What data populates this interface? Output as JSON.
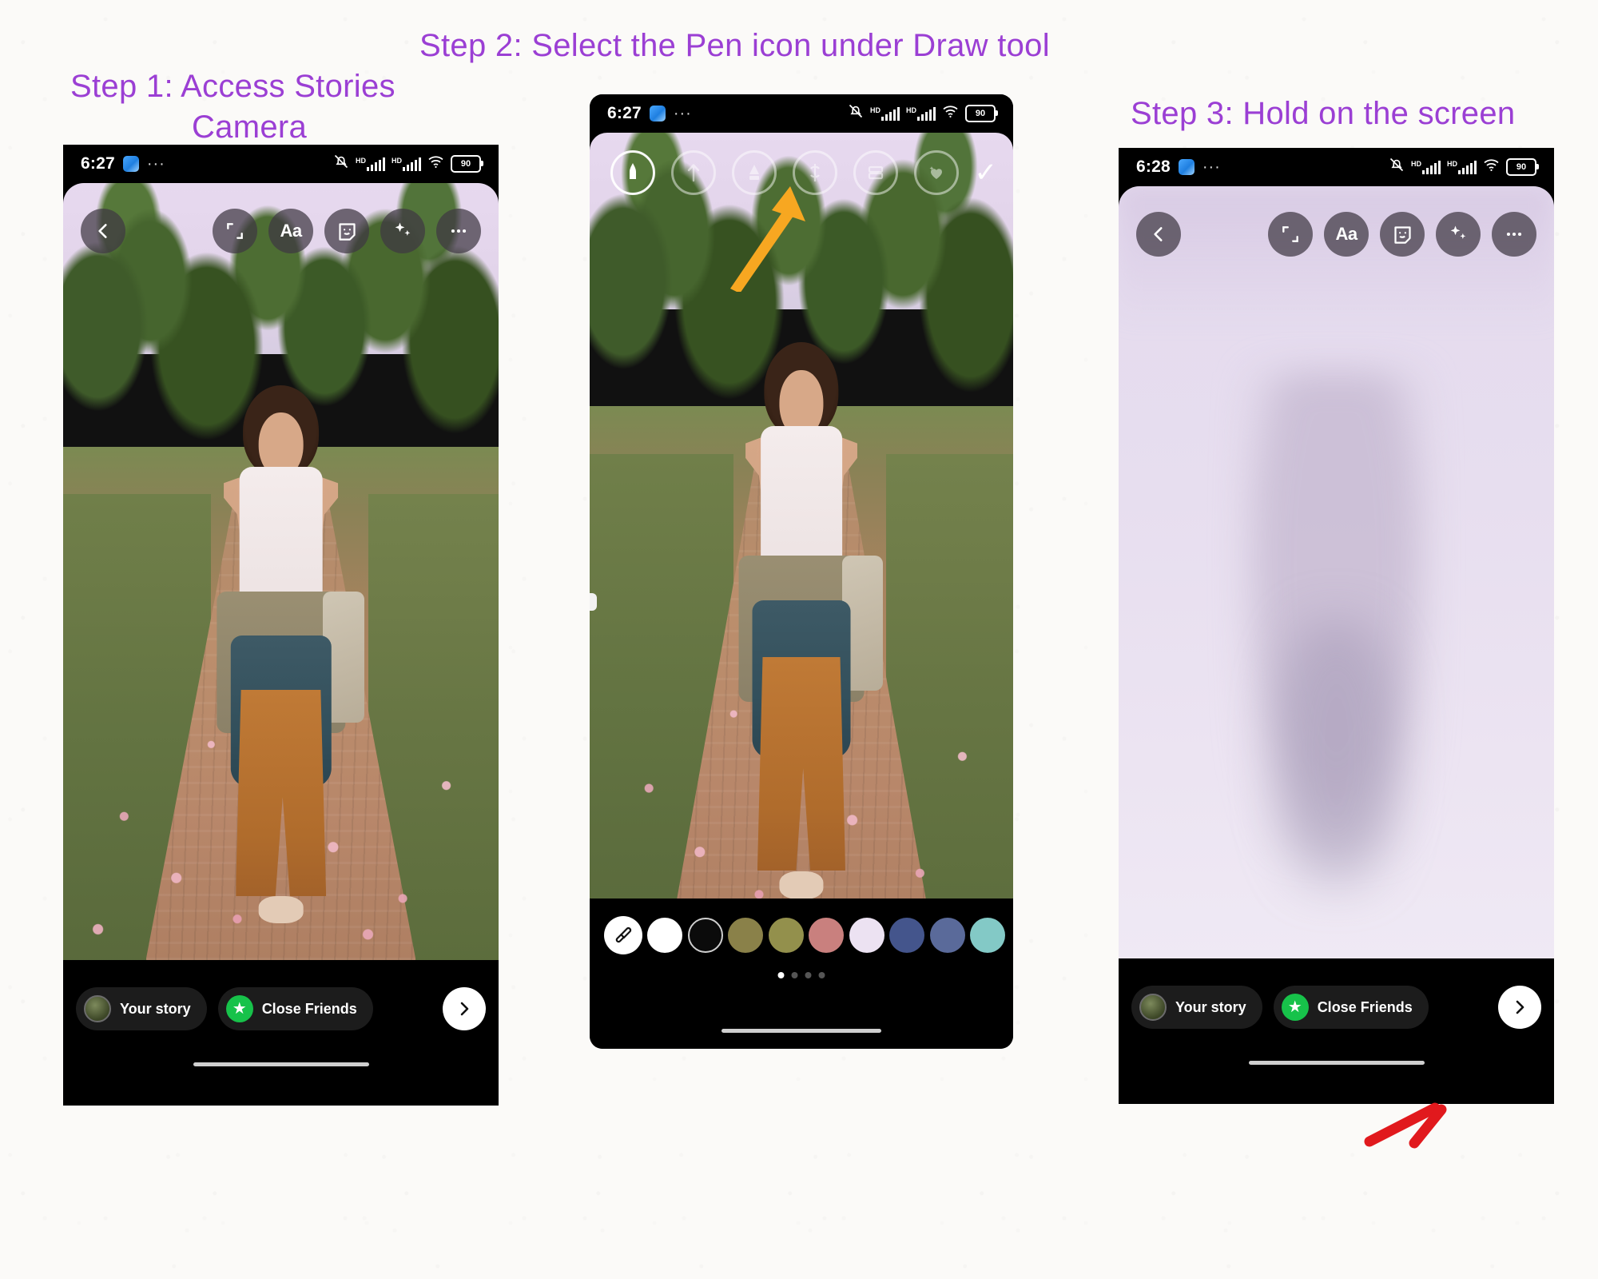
{
  "captions": {
    "step2": "Step 2: Select the Pen icon under Draw tool",
    "step1_line1": "Step 1: Access Stories",
    "step1_line2": "Camera",
    "step3": "Step 3: Hold on the screen",
    "accent_color": "#9b3fd4"
  },
  "phone1": {
    "status": {
      "time": "6:27",
      "app_icon": "messenger-icon",
      "overflow": "···",
      "mute_icon": "bell-muted-icon",
      "signal_1_label": "HD",
      "signal_2_label": "HD",
      "wifi_icon": "wifi-icon",
      "battery": "90"
    },
    "toolbar": [
      {
        "name": "back",
        "icon": "chevron-left-icon",
        "label": ""
      },
      {
        "name": "crop",
        "icon": "crop-resize-icon",
        "label": ""
      },
      {
        "name": "text",
        "icon": "text-icon",
        "label": "Aa"
      },
      {
        "name": "sticker",
        "icon": "sticker-smiley-icon",
        "label": ""
      },
      {
        "name": "effects",
        "icon": "sparkles-icon",
        "label": ""
      },
      {
        "name": "more",
        "icon": "more-horizontal-icon",
        "label": "···"
      }
    ],
    "bottom": {
      "your_story": "Your story",
      "close_friends": "Close Friends",
      "send_icon": "chevron-right-icon"
    }
  },
  "phone2": {
    "status": {
      "time": "6:27",
      "app_icon": "messenger-icon",
      "overflow": "···",
      "mute_icon": "bell-muted-icon",
      "signal_1_label": "HD",
      "signal_2_label": "HD",
      "wifi_icon": "wifi-icon",
      "battery": "90"
    },
    "draw_tools": [
      {
        "name": "pen",
        "icon": "pen-tool-icon",
        "selected": true
      },
      {
        "name": "arrow",
        "icon": "arrow-pen-icon",
        "selected": false
      },
      {
        "name": "highlighter",
        "icon": "highlighter-icon",
        "selected": false
      },
      {
        "name": "neon",
        "icon": "neon-pen-icon",
        "selected": false
      },
      {
        "name": "eraser",
        "icon": "eraser-icon",
        "selected": false
      },
      {
        "name": "sticker-pen",
        "icon": "heart-sparkle-icon",
        "selected": false
      }
    ],
    "done_label": "✓",
    "palette": {
      "eyedropper_icon": "eyedropper-icon",
      "colors": [
        "#ffffff",
        "#0b0b0b",
        "#8a8149",
        "#93904c",
        "#c9807e",
        "#ece2f2",
        "#44558c",
        "#5a6a9a",
        "#83c9c6"
      ],
      "page_dots": 4,
      "active_dot": 0
    }
  },
  "phone3": {
    "status": {
      "time": "6:28",
      "app_icon": "messenger-icon",
      "overflow": "···",
      "mute_icon": "bell-muted-icon",
      "signal_1_label": "HD",
      "signal_2_label": "HD",
      "wifi_icon": "wifi-icon",
      "battery": "90"
    },
    "toolbar": [
      {
        "name": "back",
        "icon": "chevron-left-icon",
        "label": ""
      },
      {
        "name": "crop",
        "icon": "crop-resize-icon",
        "label": ""
      },
      {
        "name": "text",
        "icon": "text-icon",
        "label": "Aa"
      },
      {
        "name": "sticker",
        "icon": "sticker-smiley-icon",
        "label": ""
      },
      {
        "name": "effects",
        "icon": "sparkles-icon",
        "label": ""
      },
      {
        "name": "more",
        "icon": "more-horizontal-icon",
        "label": "···"
      }
    ],
    "bottom": {
      "your_story": "Your story",
      "close_friends": "Close Friends",
      "send_icon": "chevron-right-icon"
    }
  },
  "annotations": {
    "orange_arrow": {
      "name": "orange-pointer-arrow",
      "color": "#f7a721",
      "target": "pen-tool-icon"
    },
    "red_arrow": {
      "name": "red-pointer-arrow",
      "color": "#e1191d",
      "target": "screen-hold-area"
    }
  }
}
